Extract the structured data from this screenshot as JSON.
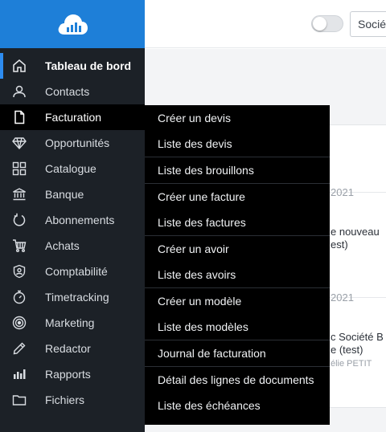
{
  "app": {
    "brand_color": "#1e7fd8",
    "logo": "cloud-chart-logo"
  },
  "sidebar": {
    "items": [
      {
        "label": "Tableau de bord",
        "icon": "home-icon",
        "state": "active"
      },
      {
        "label": "Contacts",
        "icon": "user-icon"
      },
      {
        "label": "Facturation",
        "icon": "document-icon",
        "state": "open"
      },
      {
        "label": "Opportunités",
        "icon": "diamond-icon"
      },
      {
        "label": "Catalogue",
        "icon": "grid-icon"
      },
      {
        "label": "Banque",
        "icon": "bank-icon"
      },
      {
        "label": "Abonnements",
        "icon": "refresh-icon"
      },
      {
        "label": "Achats",
        "icon": "cart-icon"
      },
      {
        "label": "Comptabilité",
        "icon": "badge-icon"
      },
      {
        "label": "Timetracking",
        "icon": "stopwatch-icon"
      },
      {
        "label": "Marketing",
        "icon": "target-icon"
      },
      {
        "label": "Redactor",
        "icon": "pencil-icon"
      },
      {
        "label": "Rapports",
        "icon": "bar-chart-icon"
      },
      {
        "label": "Fichiers",
        "icon": "folder-icon"
      }
    ]
  },
  "topbar": {
    "company_select_value": "Sociét"
  },
  "background": {
    "date1": "2021",
    "line1": "e nouveau",
    "line2": "est)",
    "date2": "2021",
    "line3": "c Société B",
    "line4": "e (test)",
    "author": "élie PETIT"
  },
  "facturation_menu": {
    "groups": [
      [
        "Créer un devis",
        "Liste des devis"
      ],
      [
        "Liste des brouillons"
      ],
      [
        "Créer une facture",
        "Liste des factures"
      ],
      [
        "Créer un avoir",
        "Liste des avoirs"
      ],
      [
        "Créer un modèle",
        "Liste des modèles"
      ],
      [
        "Journal de facturation"
      ],
      [
        "Détail des lignes de documents",
        "Liste des échéances"
      ]
    ]
  }
}
